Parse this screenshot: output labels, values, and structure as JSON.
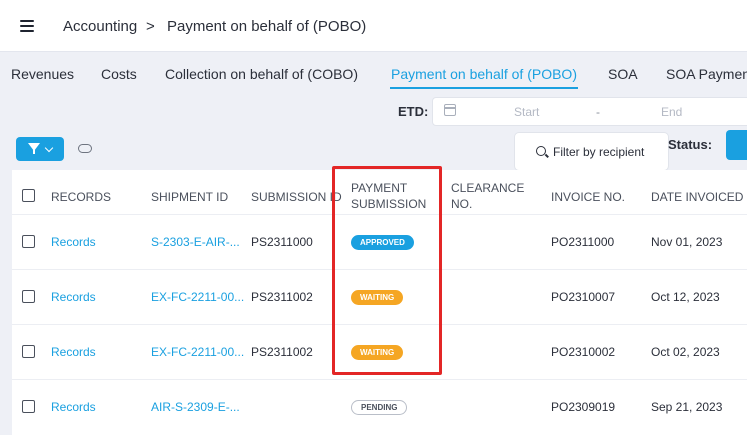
{
  "breadcrumb": {
    "section": "Accounting",
    "separator": ">",
    "page": "Payment on behalf of (POBO)"
  },
  "tabs": [
    {
      "label": "Revenues"
    },
    {
      "label": "Costs"
    },
    {
      "label": "Collection on behalf of (COBO)"
    },
    {
      "label": "Payment on behalf of (POBO)",
      "active": true
    },
    {
      "label": "SOA"
    },
    {
      "label": "SOA Paymen"
    }
  ],
  "filters": {
    "etd_label": "ETD:",
    "start_placeholder": "Start",
    "range_separator": "-",
    "end_placeholder": "End",
    "recipient_button": "Filter by recipient",
    "status_label": "Status:"
  },
  "table": {
    "columns": {
      "records": "RECORDS",
      "shipment_id": "SHIPMENT ID",
      "submission_id": "SUBMISSION ID",
      "payment_submission": "PAYMENT SUBMISSION",
      "clearance_no": "CLEARANCE NO.",
      "invoice_no": "INVOICE NO.",
      "date_invoiced": "DATE INVOICED"
    },
    "rows": [
      {
        "records": "Records",
        "shipment_id": "S-2303-E-AIR-...",
        "submission_id": "PS2311000",
        "payment_submission": "APPROVED",
        "clearance_no": "",
        "invoice_no": "PO2311000",
        "date_invoiced": "Nov 01, 2023"
      },
      {
        "records": "Records",
        "shipment_id": "EX-FC-2211-00...",
        "submission_id": "PS2311002",
        "payment_submission": "WAITING",
        "clearance_no": "",
        "invoice_no": "PO2310007",
        "date_invoiced": "Oct 12, 2023"
      },
      {
        "records": "Records",
        "shipment_id": "EX-FC-2211-00...",
        "submission_id": "PS2311002",
        "payment_submission": "WAITING",
        "clearance_no": "",
        "invoice_no": "PO2310002",
        "date_invoiced": "Oct 02, 2023"
      },
      {
        "records": "Records",
        "shipment_id": "AIR-S-2309-E-...",
        "submission_id": "",
        "payment_submission": "PENDING",
        "clearance_no": "",
        "invoice_no": "PO2309019",
        "date_invoiced": "Sep 21, 2023"
      }
    ]
  },
  "colors": {
    "accent": "#1aa0e0",
    "approved": "#1aa0e0",
    "waiting": "#f5a623",
    "highlight": "#e32626"
  }
}
